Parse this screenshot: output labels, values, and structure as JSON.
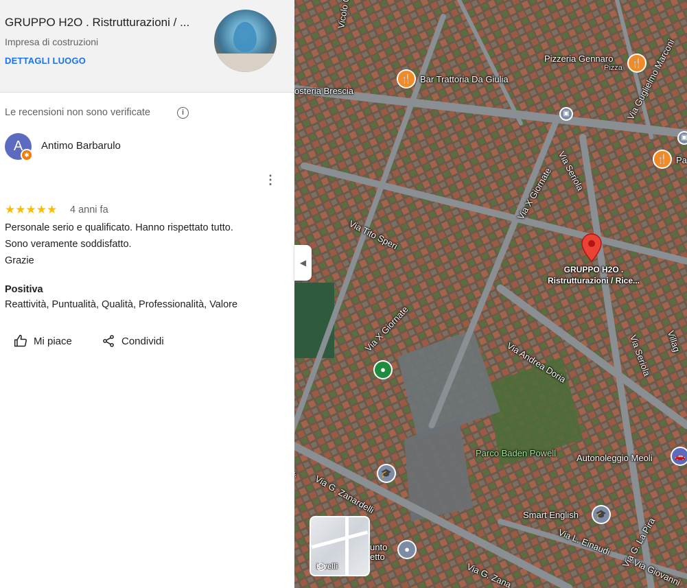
{
  "place": {
    "title": "GRUPPO H2O . Ristrutturazioni / ...",
    "category": "Impresa di costruzioni",
    "details_link": "DETTAGLI LUOGO"
  },
  "review_notice": "Le recensioni non sono verificate",
  "info_icon": "i",
  "review": {
    "avatar_initial": "A",
    "badge_icon": "✱",
    "reviewer": "Antimo Barbarulo",
    "more_icon": "⋮",
    "stars": "★★★★★",
    "rating": 5,
    "age": "4 anni fa",
    "text_lines": [
      "Personale serio e qualificato. Hanno rispettato tutto.",
      "Sono veramente soddisfatto.",
      "Grazie"
    ],
    "positive_label": "Positiva",
    "positive_values": "Reattività, Puntualità, Qualità, Professionalità, Valore"
  },
  "actions": {
    "like": "Mi piace",
    "share": "Condividi"
  },
  "collapse_icon": "◀",
  "map": {
    "selected_place": [
      "GRUPPO H2O .",
      "Ristrutturazioni / Rice..."
    ],
    "streets": [
      "Vicolo Chiese",
      "osteria Brescia",
      "Via X Giornate",
      "Via Seriola",
      "Via Tito Speri",
      "Via X Giornate",
      "Via Andrea Doria",
      "Via Seriola",
      "Via Guglielmo Marconi",
      "Via G. Zanardelli",
      "Via L. Einaudi",
      "Via G. La Pira",
      "Via Giovanni",
      "Via G. Zana",
      "Villag",
      "elli"
    ],
    "pois": [
      "Pizzeria Gennaro",
      "Pizza",
      "Bar Trattoria Da Giulia",
      "Pa",
      "Parco Baden Powell",
      "Autonoleggio Meoli",
      "Smart English",
      "unto",
      "etto"
    ],
    "layers_label": "Livelli",
    "colors": {
      "restaurant": "#f28b24",
      "pin": "#ea4335",
      "park": "#1e8e3e",
      "education": "#7d8ba5"
    }
  }
}
